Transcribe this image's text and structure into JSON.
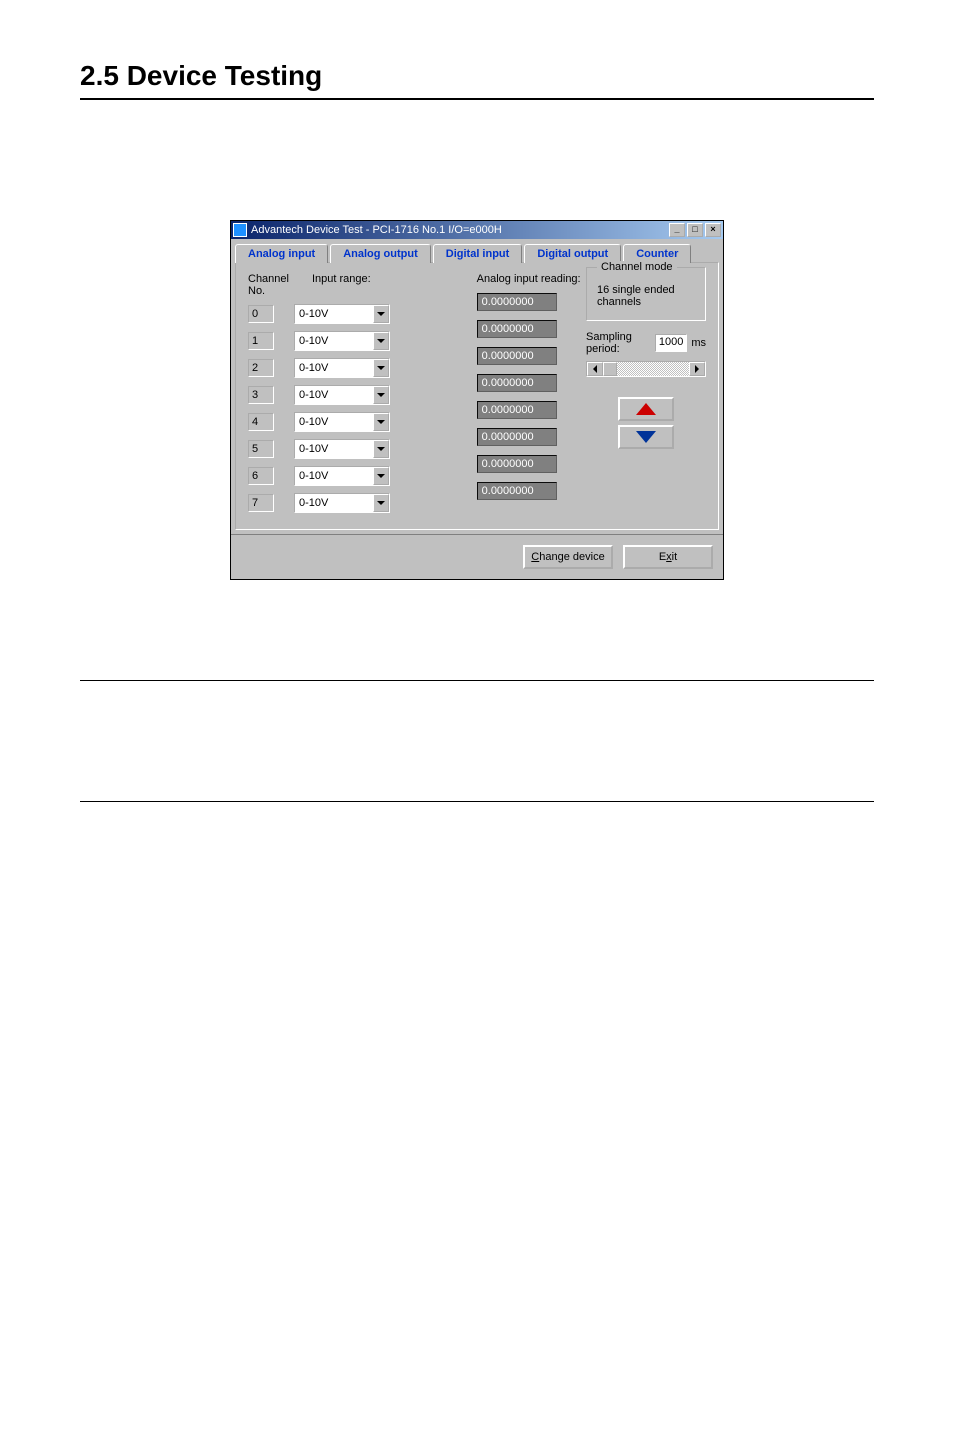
{
  "doc": {
    "section_title": "2.5   Device Testing"
  },
  "window": {
    "title": "Advantech Device Test - PCI-1716   No.1  I/O=e000H",
    "tabs": {
      "analog_input": "Analog input",
      "analog_output": "Analog output",
      "digital_input": "Digital input",
      "digital_output": "Digital output",
      "counter": "Counter"
    },
    "labels": {
      "channel_no": "Channel No.",
      "input_range": "Input range:",
      "analog_input_reading": "Analog input reading:",
      "channel_mode": "Channel mode",
      "mode_text": "16  single ended channels",
      "sampling_period": "Sampling period:",
      "sampling_value": "1000",
      "sampling_unit": "ms"
    },
    "channels": [
      {
        "num": "0",
        "range": "0-10V",
        "reading": "0.0000000"
      },
      {
        "num": "1",
        "range": "0-10V",
        "reading": "0.0000000"
      },
      {
        "num": "2",
        "range": "0-10V",
        "reading": "0.0000000"
      },
      {
        "num": "3",
        "range": "0-10V",
        "reading": "0.0000000"
      },
      {
        "num": "4",
        "range": "0-10V",
        "reading": "0.0000000"
      },
      {
        "num": "5",
        "range": "0-10V",
        "reading": "0.0000000"
      },
      {
        "num": "6",
        "range": "0-10V",
        "reading": "0.0000000"
      },
      {
        "num": "7",
        "range": "0-10V",
        "reading": "0.0000000"
      }
    ],
    "buttons": {
      "change_device": "Change device",
      "exit": "Exit"
    }
  }
}
